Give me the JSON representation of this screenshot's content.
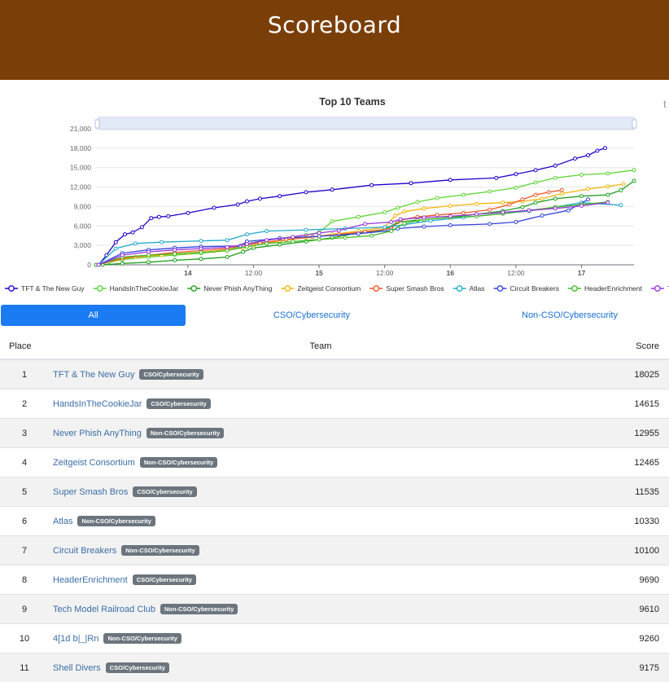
{
  "header": {
    "title": "Scoreboard"
  },
  "chart_data": {
    "type": "line",
    "title": "Top 10 Teams",
    "toolbox_glyph": "t",
    "ylim": [
      0,
      21000
    ],
    "yticks": [
      0,
      3000,
      6000,
      9000,
      12000,
      15000,
      18000,
      21000
    ],
    "ytick_labels": [
      "0",
      "3,000",
      "6,000",
      "9,000",
      "12,000",
      "15,000",
      "18,000",
      "21,000"
    ],
    "xlim": [
      13.3,
      17.4
    ],
    "xticks": [
      {
        "x": 14.0,
        "label": "14",
        "bold": true
      },
      {
        "x": 14.5,
        "label": "12:00",
        "bold": false
      },
      {
        "x": 15.0,
        "label": "15",
        "bold": true
      },
      {
        "x": 15.5,
        "label": "12:00",
        "bold": false
      },
      {
        "x": 16.0,
        "label": "16",
        "bold": true
      },
      {
        "x": 16.5,
        "label": "12:00",
        "bold": false
      },
      {
        "x": 17.0,
        "label": "17",
        "bold": true
      }
    ],
    "grid": true,
    "legend_position": "bottom",
    "series": [
      {
        "name": "TFT & The New Guy",
        "color": "#2200cc",
        "x": [
          13.32,
          13.38,
          13.45,
          13.52,
          13.58,
          13.65,
          13.72,
          13.78,
          13.85,
          14.0,
          14.2,
          14.38,
          14.45,
          14.55,
          14.7,
          14.9,
          15.1,
          15.4,
          15.7,
          16.0,
          16.35,
          16.5,
          16.65,
          16.8,
          16.95,
          17.05,
          17.12,
          17.18
        ],
        "y": [
          0,
          1500,
          3500,
          4700,
          5000,
          5800,
          7200,
          7400,
          7500,
          8000,
          8800,
          9300,
          9800,
          10200,
          10600,
          11200,
          11600,
          12300,
          12600,
          13100,
          13400,
          14000,
          14600,
          15300,
          16400,
          16900,
          17600,
          18025
        ]
      },
      {
        "name": "HandsInTheCookieJar",
        "color": "#5bd433",
        "x": [
          13.32,
          13.4,
          13.5,
          13.7,
          13.9,
          14.1,
          14.3,
          14.42,
          14.5,
          14.7,
          14.9,
          15.0,
          15.1,
          15.3,
          15.5,
          15.6,
          15.75,
          15.9,
          16.1,
          16.3,
          16.5,
          16.65,
          16.8,
          17.0,
          17.2,
          17.4
        ],
        "y": [
          0,
          400,
          800,
          1200,
          1500,
          1800,
          2200,
          3000,
          3500,
          4100,
          4600,
          5000,
          6700,
          7400,
          8100,
          8800,
          9700,
          10300,
          10800,
          11300,
          11900,
          12700,
          13400,
          13900,
          14100,
          14615
        ]
      },
      {
        "name": "Never Phish AnyThing",
        "color": "#1e9e1e",
        "x": [
          13.3,
          13.35,
          13.5,
          13.7,
          13.9,
          14.1,
          14.3,
          14.42,
          14.5,
          14.7,
          14.9,
          15.1,
          15.3,
          15.5,
          15.6,
          15.75,
          16.0,
          16.2,
          16.4,
          16.55,
          16.65,
          16.8,
          17.0,
          17.2,
          17.3,
          17.4
        ],
        "y": [
          0,
          0,
          200,
          400,
          700,
          900,
          1200,
          2000,
          2600,
          3100,
          3600,
          4200,
          4900,
          5400,
          6600,
          6900,
          7300,
          7800,
          8300,
          8900,
          9600,
          10200,
          10600,
          10800,
          11500,
          12955
        ]
      },
      {
        "name": "Zeitgeist Consortium",
        "color": "#f2b50c",
        "x": [
          13.32,
          13.45,
          13.6,
          13.8,
          14.0,
          14.2,
          14.42,
          14.5,
          14.7,
          14.9,
          15.1,
          15.3,
          15.5,
          15.58,
          15.65,
          15.8,
          16.0,
          16.2,
          16.4,
          16.55,
          16.7,
          16.85,
          17.05,
          17.2,
          17.32
        ],
        "y": [
          0,
          800,
          1200,
          1500,
          1800,
          2100,
          2600,
          3000,
          3700,
          4200,
          4700,
          5200,
          5800,
          7600,
          8200,
          8700,
          9100,
          9400,
          9600,
          9800,
          10200,
          11000,
          11700,
          12100,
          12465
        ]
      },
      {
        "name": "Super Smash Bros",
        "color": "#ee5522",
        "x": [
          13.32,
          13.5,
          13.7,
          13.9,
          14.1,
          14.3,
          14.42,
          14.55,
          14.75,
          14.95,
          15.15,
          15.35,
          15.55,
          15.62,
          15.75,
          15.9,
          16.1,
          16.3,
          16.45,
          16.55,
          16.65,
          16.75,
          16.85
        ],
        "y": [
          0,
          1000,
          1500,
          1900,
          2200,
          2500,
          3000,
          3400,
          3900,
          4300,
          4700,
          5100,
          5600,
          6900,
          7400,
          7700,
          8000,
          8500,
          9300,
          10100,
          10800,
          11200,
          11535
        ]
      },
      {
        "name": "Atlas",
        "color": "#22aacc",
        "x": [
          13.32,
          13.45,
          13.6,
          13.8,
          14.1,
          14.3,
          14.45,
          14.6,
          14.9,
          15.2,
          15.5,
          15.65,
          15.85,
          16.1,
          16.4,
          16.6,
          16.8,
          17.0,
          17.3
        ],
        "y": [
          0,
          2500,
          3300,
          3500,
          3700,
          3800,
          4700,
          5200,
          5400,
          5600,
          5800,
          6200,
          6800,
          7300,
          7900,
          8300,
          8900,
          9600,
          9200
        ]
      },
      {
        "name": "Circuit Breakers",
        "color": "#3344dd",
        "x": [
          13.32,
          13.5,
          13.7,
          13.9,
          14.1,
          14.4,
          14.45,
          14.7,
          15.0,
          15.3,
          15.55,
          15.6,
          15.8,
          16.0,
          16.3,
          16.5,
          16.7,
          16.9,
          17.05
        ],
        "y": [
          0,
          1800,
          2300,
          2600,
          2800,
          2900,
          3600,
          4100,
          4400,
          4800,
          5300,
          5600,
          5900,
          6100,
          6300,
          6600,
          7600,
          8400,
          10100
        ]
      },
      {
        "name": "HeaderEnrichment",
        "color": "#44bb22",
        "x": [
          13.32,
          13.5,
          13.7,
          13.9,
          14.1,
          14.3,
          14.45,
          14.6,
          14.8,
          15.0,
          15.2,
          15.4,
          15.55,
          15.65,
          15.8,
          16.0,
          16.2,
          16.4,
          16.6,
          16.8,
          17.0,
          17.2
        ],
        "y": [
          0,
          1200,
          1500,
          1700,
          1900,
          2200,
          2800,
          3300,
          3600,
          3900,
          4200,
          4500,
          5200,
          6400,
          7000,
          7300,
          7500,
          7900,
          8400,
          8900,
          9300,
          9690
        ]
      },
      {
        "name": "Tech Model Railroad Club",
        "color": "#9933dd",
        "x": [
          13.32,
          13.5,
          13.7,
          13.9,
          14.1,
          14.3,
          14.45,
          14.6,
          14.8,
          15.0,
          15.15,
          15.35,
          15.55,
          15.62,
          15.8,
          16.0,
          16.2,
          16.4,
          16.6,
          16.8,
          17.0,
          17.2
        ],
        "y": [
          0,
          1500,
          2000,
          2300,
          2500,
          2700,
          3200,
          3800,
          4300,
          4900,
          5300,
          6300,
          6600,
          7000,
          7300,
          7500,
          7800,
          8100,
          8400,
          8700,
          9100,
          9610
        ]
      }
    ],
    "legend": [
      {
        "name": "TFT & The New Guy",
        "color": "#2200cc"
      },
      {
        "name": "HandsInTheCookieJar",
        "color": "#5bd433"
      },
      {
        "name": "Never Phish AnyThing",
        "color": "#1e9e1e"
      },
      {
        "name": "Zeitgeist Consortium",
        "color": "#f2b50c"
      },
      {
        "name": "Super Smash Bros",
        "color": "#ee5522"
      },
      {
        "name": "Atlas",
        "color": "#22aacc"
      },
      {
        "name": "Circuit Breakers",
        "color": "#3344dd"
      },
      {
        "name": "HeaderEnrichment",
        "color": "#44bb22"
      },
      {
        "name": "Tech Mc",
        "color": "#9933dd"
      }
    ]
  },
  "filters": {
    "all": "All",
    "cso": "CSO/Cybersecurity",
    "noncso": "Non-CSO/Cybersecurity"
  },
  "table": {
    "headers": {
      "place": "Place",
      "team": "Team",
      "score": "Score"
    },
    "rows": [
      {
        "place": "1",
        "team": "TFT & The New Guy",
        "badge": "CSO/Cybersecurity",
        "score": "18025"
      },
      {
        "place": "2",
        "team": "HandsInTheCookieJar",
        "badge": "CSO/Cybersecurity",
        "score": "14615"
      },
      {
        "place": "3",
        "team": "Never Phish AnyThing",
        "badge": "Non-CSO/Cybersecurity",
        "score": "12955"
      },
      {
        "place": "4",
        "team": "Zeitgeist Consortium",
        "badge": "Non-CSO/Cybersecurity",
        "score": "12465"
      },
      {
        "place": "5",
        "team": "Super Smash Bros",
        "badge": "CSO/Cybersecurity",
        "score": "11535"
      },
      {
        "place": "6",
        "team": "Atlas",
        "badge": "Non-CSO/Cybersecurity",
        "score": "10330"
      },
      {
        "place": "7",
        "team": "Circuit Breakers",
        "badge": "Non-CSO/Cybersecurity",
        "score": "10100"
      },
      {
        "place": "8",
        "team": "HeaderEnrichment",
        "badge": "CSO/Cybersecurity",
        "score": "9690"
      },
      {
        "place": "9",
        "team": "Tech Model Railroad Club",
        "badge": "Non-CSO/Cybersecurity",
        "score": "9610"
      },
      {
        "place": "10",
        "team": "4[1d b|_|Rn",
        "badge": "Non-CSO/Cybersecurity",
        "score": "9260"
      },
      {
        "place": "11",
        "team": "Shell Divers",
        "badge": "CSO/Cybersecurity",
        "score": "9175"
      }
    ]
  }
}
